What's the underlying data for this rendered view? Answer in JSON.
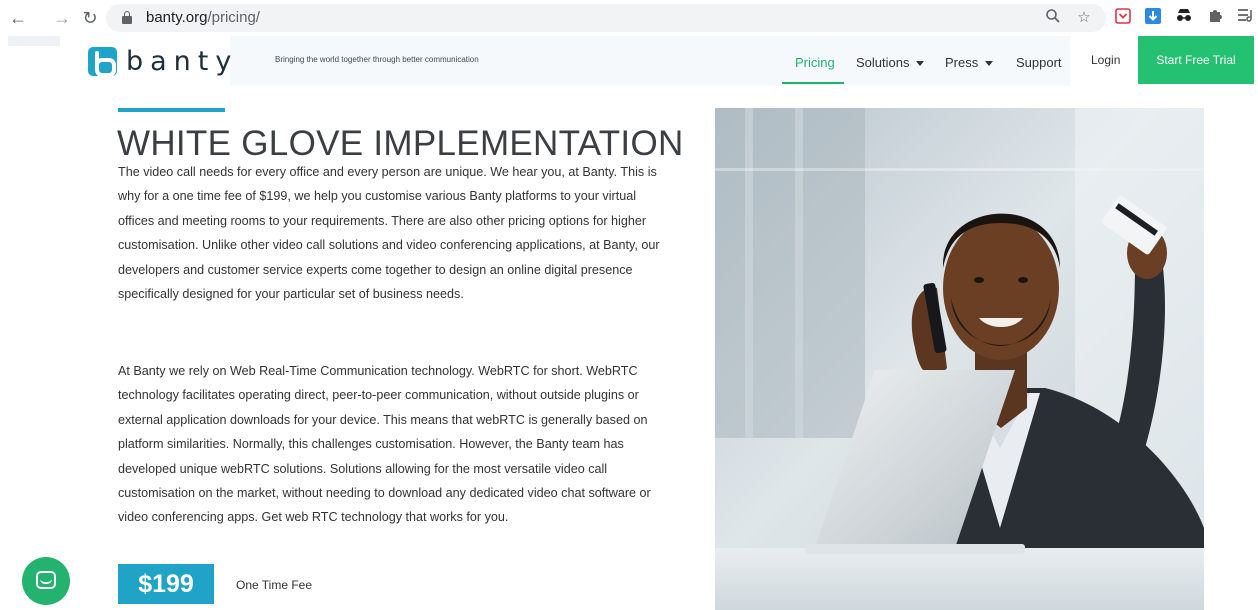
{
  "browser": {
    "url_host": "banty.org",
    "url_path": "/pricing/",
    "nav_icons": [
      "back-arrow-icon",
      "forward-arrow-icon",
      "reload-icon"
    ],
    "toolbar_icons": [
      "zoom-icon",
      "bookmark-star-icon",
      "pocket-extension-icon",
      "download-extension-icon",
      "incognito-extension-icon",
      "extensions-puzzle-icon",
      "reading-list-icon"
    ]
  },
  "header": {
    "logo_text": "banty",
    "tagline": "Bringing the world together through better communication",
    "nav": {
      "pricing": "Pricing",
      "solutions": "Solutions",
      "press": "Press",
      "support": "Support"
    },
    "login": "Login",
    "cta": "Start Free Trial"
  },
  "main": {
    "title": "WHITE GLOVE IMPLEMENTATION",
    "paragraph_1": "The video call needs for every office and every person are unique. We hear you, at Banty. This is why for a one time fee of $199, we help you customise various Banty platforms to your virtual offices and meeting rooms to your requirements. There are also other pricing options for higher customisation. Unlike other video call solutions and video conferencing applications, at Banty, our developers and customer service experts come together to design an online digital presence specifically designed for your particular set of business needs.",
    "paragraph_2": "At Banty we rely on Web Real-Time Communication technology. WebRTC for short. WebRTC technology facilitates operating direct, peer-to-peer communication, without outside plugins or external application downloads for your device. This means that webRTC is generally based on platform similarities. Normally, this challenges customisation. However, the Banty team has developed unique webRTC solutions. Solutions allowing for the most versatile video call customisation on the market, without needing to download any dedicated video chat software or video conferencing apps. Get web RTC technology that works for you.",
    "price": "$199",
    "price_label": "One Time Fee"
  },
  "colors": {
    "brand_blue": "#1fa3c7",
    "brand_green": "#25c172",
    "nav_active": "#20b16f"
  }
}
